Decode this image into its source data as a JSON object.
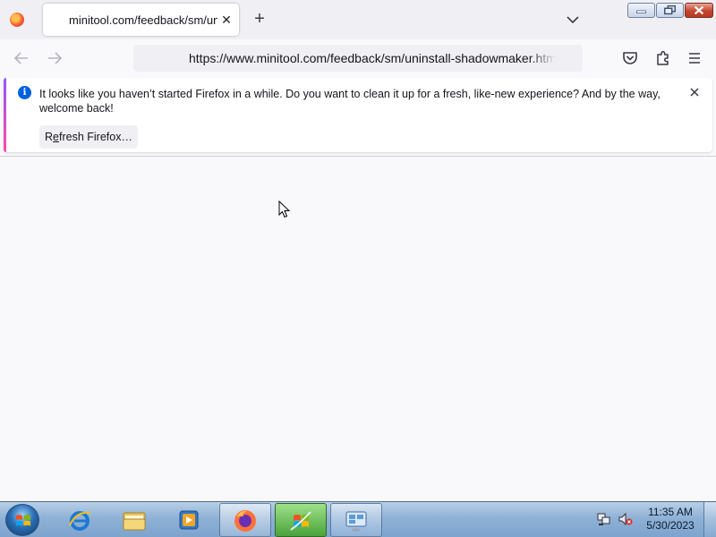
{
  "tab": {
    "title": "minitool.com/feedback/sm/uninstall-shadowmaker.html"
  },
  "navbar": {
    "url": "https://www.minitool.com/feedback/sm/uninstall-shadowmaker.html"
  },
  "notification": {
    "message": "It looks like you haven’t started Firefox in a while. Do you want to clean it up for a fresh, like-new experience? And by the way, welcome back!",
    "button_prefix": "R",
    "button_accel": "e",
    "button_rest": "fresh Firefox…"
  },
  "taskbar": {
    "time": "11:35 AM",
    "date": "5/30/2023",
    "items": [
      "internet-explorer",
      "windows-explorer",
      "media-player",
      "firefox",
      "windows-update",
      "control-panel"
    ]
  },
  "colors": {
    "accent_start": "#9059ff",
    "accent_end": "#ff4aa2",
    "info_blue": "#0060df"
  }
}
